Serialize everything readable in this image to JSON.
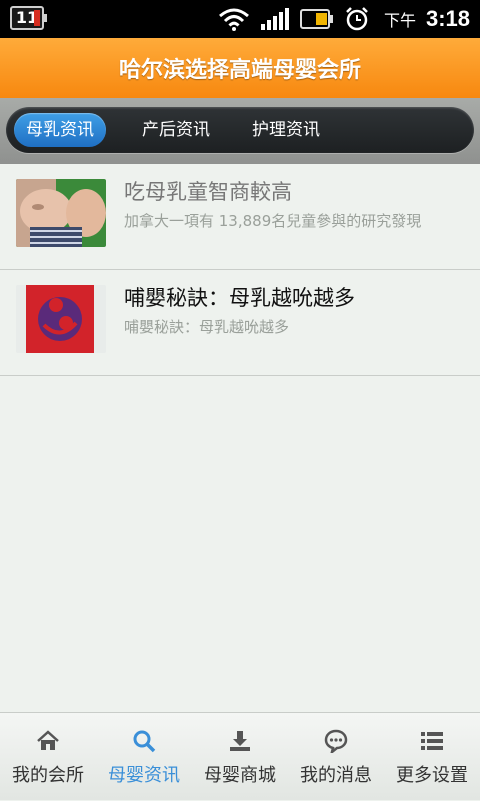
{
  "status_bar": {
    "notification_count": "11",
    "afternoon_label": "下午",
    "time": "3:18"
  },
  "header": {
    "title": "哈尔滨选择高端母婴会所"
  },
  "tabs": [
    {
      "label": "母乳资讯",
      "active": true
    },
    {
      "label": "产后资讯",
      "active": false
    },
    {
      "label": "护理资讯",
      "active": false
    }
  ],
  "articles": [
    {
      "title": "吃母乳童智商較高",
      "summary": "加拿大一項有 13,889名兒童參與的研究發現"
    },
    {
      "title": "哺嬰秘訣：母乳越吮越多",
      "summary": "哺嬰秘訣：母乳越吮越多"
    }
  ],
  "bottom_nav": [
    {
      "label": "我的会所",
      "icon": "home-icon",
      "active": false
    },
    {
      "label": "母婴资讯",
      "icon": "search-icon",
      "active": true
    },
    {
      "label": "母婴商城",
      "icon": "download-icon",
      "active": false
    },
    {
      "label": "我的消息",
      "icon": "chat-bubble-icon",
      "active": false
    },
    {
      "label": "更多设置",
      "icon": "list-icon",
      "active": false
    }
  ],
  "colors": {
    "header_orange": "#f7880f",
    "active_tab_blue": "#1f6fc4",
    "active_nav_blue": "#3a8fd8"
  }
}
